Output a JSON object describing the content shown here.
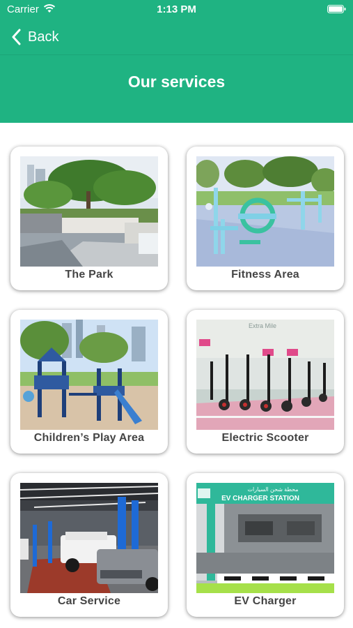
{
  "status_bar": {
    "carrier": "Carrier",
    "time": "1:13 PM",
    "wifi_icon": "wifi-icon",
    "battery_icon": "battery-icon"
  },
  "nav": {
    "back_label": "Back",
    "back_icon": "chevron-left-icon"
  },
  "header": {
    "title": "Our services",
    "color": "#1fb382"
  },
  "services": [
    {
      "label": "The Park"
    },
    {
      "label": "Fitness Area"
    },
    {
      "label": "Children’s Play Area"
    },
    {
      "label": "Electric Scooter"
    },
    {
      "label": "Car Service"
    },
    {
      "label": "EV Charger"
    }
  ],
  "images": {
    "scooter_sign": "Extra Mile",
    "ev_sign_arabic": "محطة شحن السيارات",
    "ev_sign": "EV CHARGER STATION"
  }
}
